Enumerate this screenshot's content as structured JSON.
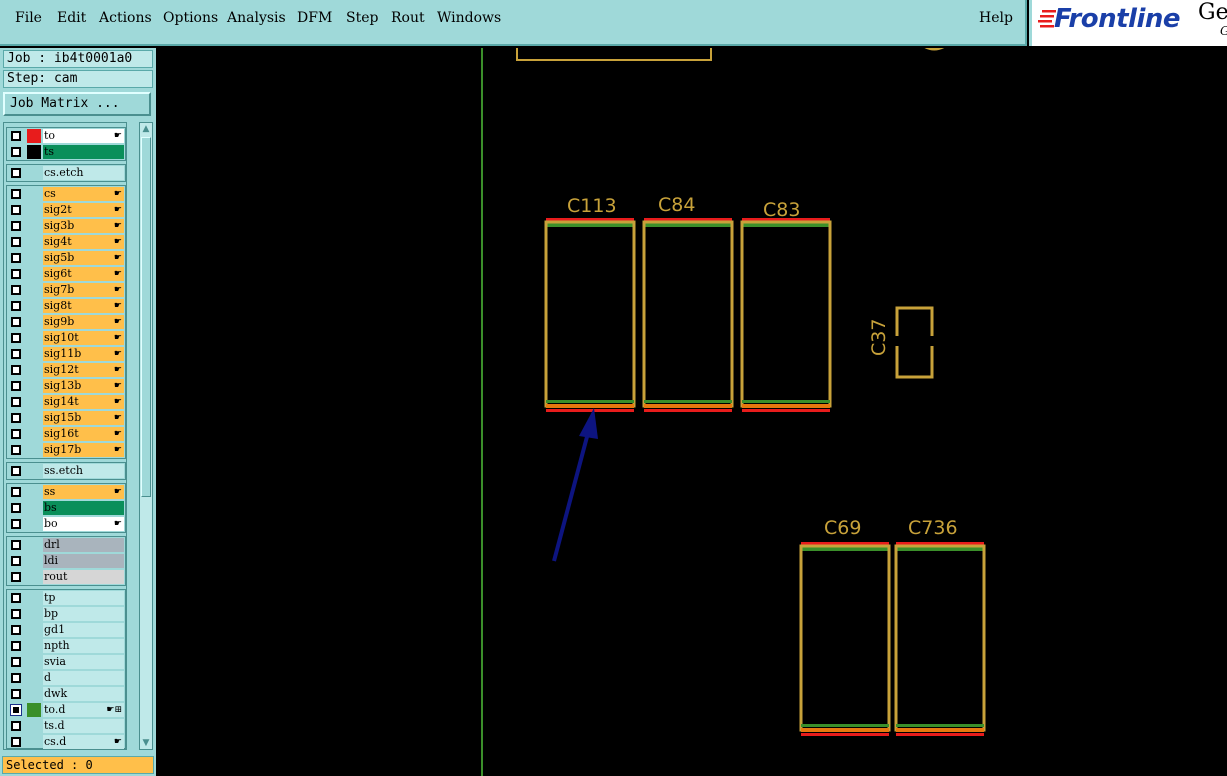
{
  "menu": {
    "file": "File",
    "edit": "Edit",
    "actions": "Actions",
    "options": "Options",
    "analysis": "Analysis",
    "dfm": "DFM",
    "step": "Step",
    "rout": "Rout",
    "windows": "Windows",
    "help": "Help"
  },
  "logo": {
    "brand": "Frontline",
    "ge": "Ge",
    "g": "G"
  },
  "panel": {
    "job": "Job : ib4t0001a0",
    "step": "Step: cam",
    "job_matrix": "Job Matrix ...",
    "selected": "Selected : 0"
  },
  "layers": {
    "to": "to",
    "ts": "ts",
    "cs_etch": "cs.etch",
    "cs": "cs",
    "sig2t": "sig2t",
    "sig3b": "sig3b",
    "sig4t": "sig4t",
    "sig5b": "sig5b",
    "sig6t": "sig6t",
    "sig7b": "sig7b",
    "sig8t": "sig8t",
    "sig9b": "sig9b",
    "sig10t": "sig10t",
    "sig11b": "sig11b",
    "sig12t": "sig12t",
    "sig13b": "sig13b",
    "sig14t": "sig14t",
    "sig15b": "sig15b",
    "sig16t": "sig16t",
    "sig17b": "sig17b",
    "ss_etch": "ss.etch",
    "ss": "ss",
    "bs": "bs",
    "bo": "bo",
    "drl": "drl",
    "ldi": "ldi",
    "rout": "rout",
    "tp": "tp",
    "bp": "bp",
    "gd1": "gd1",
    "npth": "npth",
    "svia": "svia",
    "d": "d",
    "dwk": "dwk",
    "to_d": "to.d",
    "ts_d": "ts.d",
    "cs_d": "cs.d"
  },
  "components": {
    "c113": "C113",
    "c84": "C84",
    "c83": "C83",
    "c37": "C37",
    "c69": "C69",
    "c736": "C736"
  },
  "colors": {
    "outline": "#c8a23a",
    "pad_red": "#e81c1c",
    "pad_green": "#3b8f2a",
    "pad_orange": "#e8780e",
    "arrow": "#0d1480",
    "board_edge": "#3b8f2a"
  }
}
